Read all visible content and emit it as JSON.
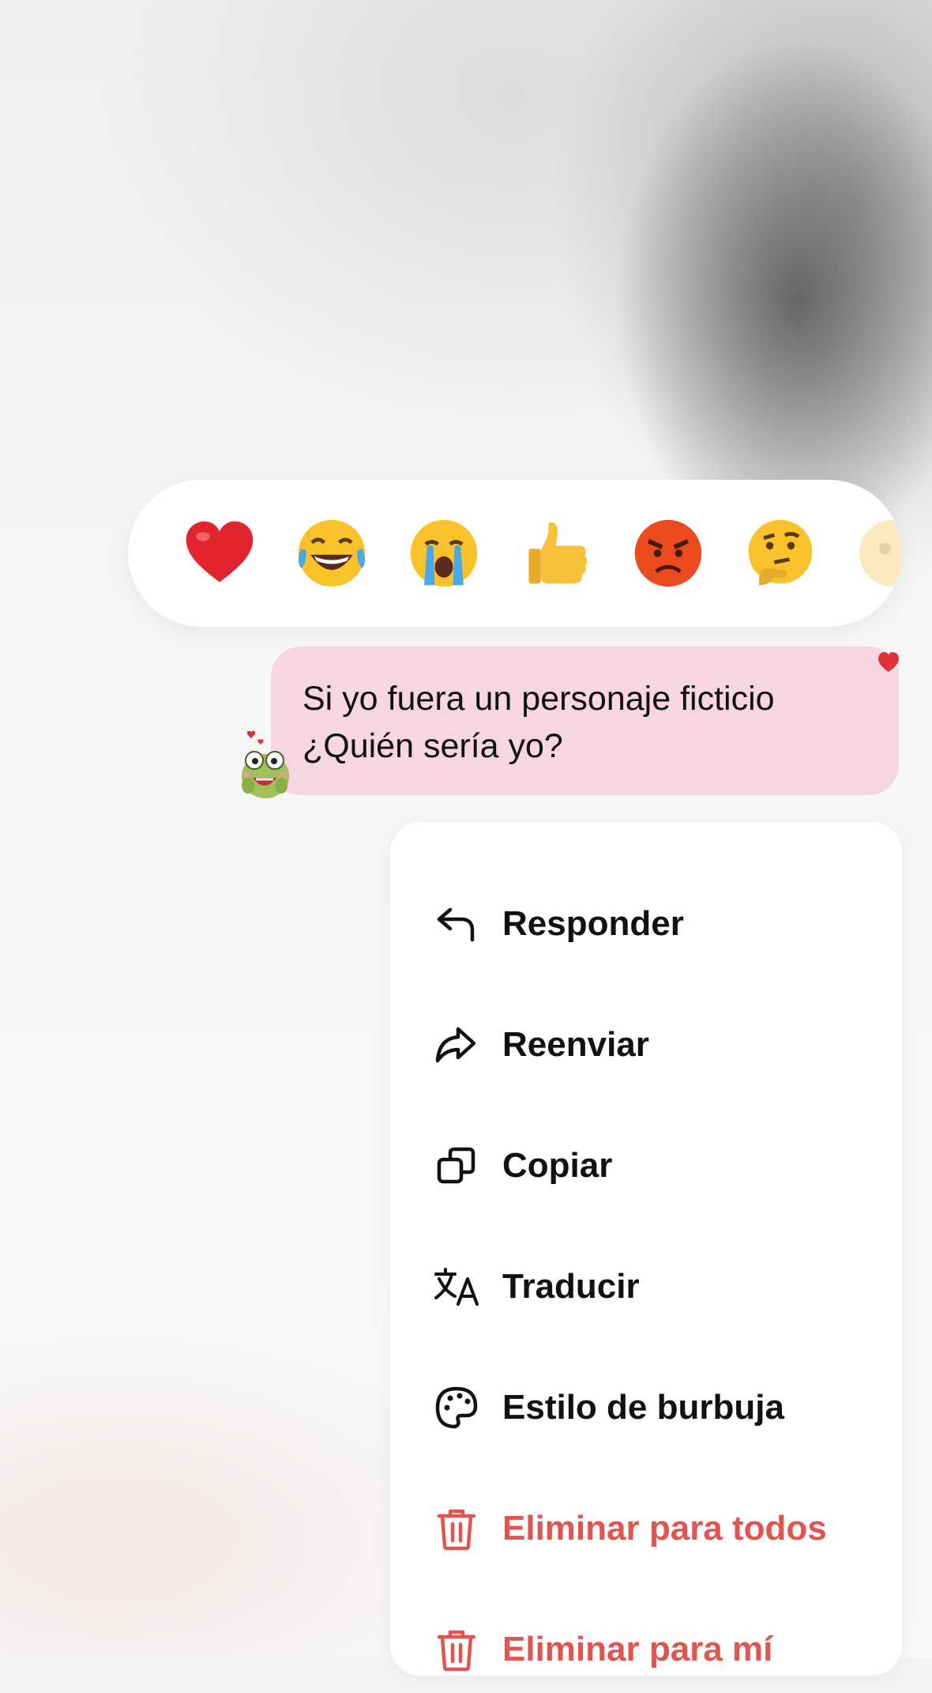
{
  "reactions": [
    {
      "name": "red-heart"
    },
    {
      "name": "face-with-tears-of-joy"
    },
    {
      "name": "loudly-crying-face"
    },
    {
      "name": "thumbs-up"
    },
    {
      "name": "angry-face"
    },
    {
      "name": "thinking-face"
    },
    {
      "name": "face-partially-visible"
    }
  ],
  "message": {
    "line1": "Si yo fuera un personaje ficticio",
    "line2": "¿Quién sería yo?",
    "bubble_color": "#f5d6e2",
    "reaction_badge": "heart"
  },
  "menu": {
    "items": [
      {
        "label": "Responder",
        "icon": "reply-icon"
      },
      {
        "label": "Reenviar",
        "icon": "forward-icon"
      },
      {
        "label": "Copiar",
        "icon": "copy-icon"
      },
      {
        "label": "Traducir",
        "icon": "translate-icon"
      },
      {
        "label": "Estilo de burbuja",
        "icon": "palette-icon"
      },
      {
        "label": "Eliminar para todos",
        "icon": "trash-icon",
        "color": "#e0554f"
      },
      {
        "label": "Eliminar para mí",
        "icon": "trash-icon",
        "color": "#e0554f"
      }
    ]
  }
}
